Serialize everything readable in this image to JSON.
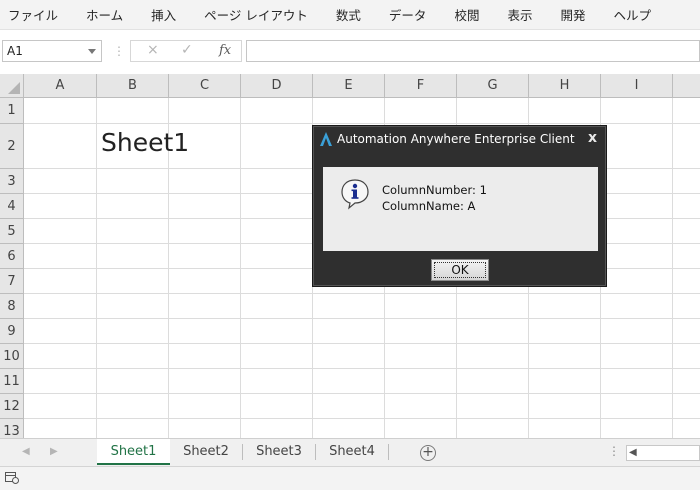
{
  "ribbon": {
    "tabs": [
      "ファイル",
      "ホーム",
      "挿入",
      "ページ レイアウト",
      "数式",
      "データ",
      "校閲",
      "表示",
      "開発",
      "ヘルプ"
    ]
  },
  "formula_bar": {
    "name_box": "A1",
    "cancel_icon": "×",
    "enter_icon": "✓",
    "function_label": "fx",
    "formula_value": ""
  },
  "grid": {
    "columns": [
      "A",
      "B",
      "C",
      "D",
      "E",
      "F",
      "G",
      "H",
      "I"
    ],
    "rows": [
      "1",
      "2",
      "3",
      "4",
      "5",
      "6",
      "7",
      "8",
      "9",
      "10",
      "11",
      "12",
      "13"
    ],
    "cell_b2": "Sheet1"
  },
  "dialog": {
    "title": "Automation Anywhere Enterprise Client",
    "close_label": "x",
    "line1": "ColumnNumber: 1",
    "line2": "ColumnName: A",
    "ok_label": "OK",
    "icon": "info-icon"
  },
  "sheets": {
    "tabs": [
      "Sheet1",
      "Sheet2",
      "Sheet3",
      "Sheet4"
    ],
    "active": "Sheet1",
    "add_label": "+"
  },
  "colors": {
    "active_tab": "#217346",
    "dialog_bg": "#2f2f2f",
    "header_bg": "#e6e6e6"
  }
}
